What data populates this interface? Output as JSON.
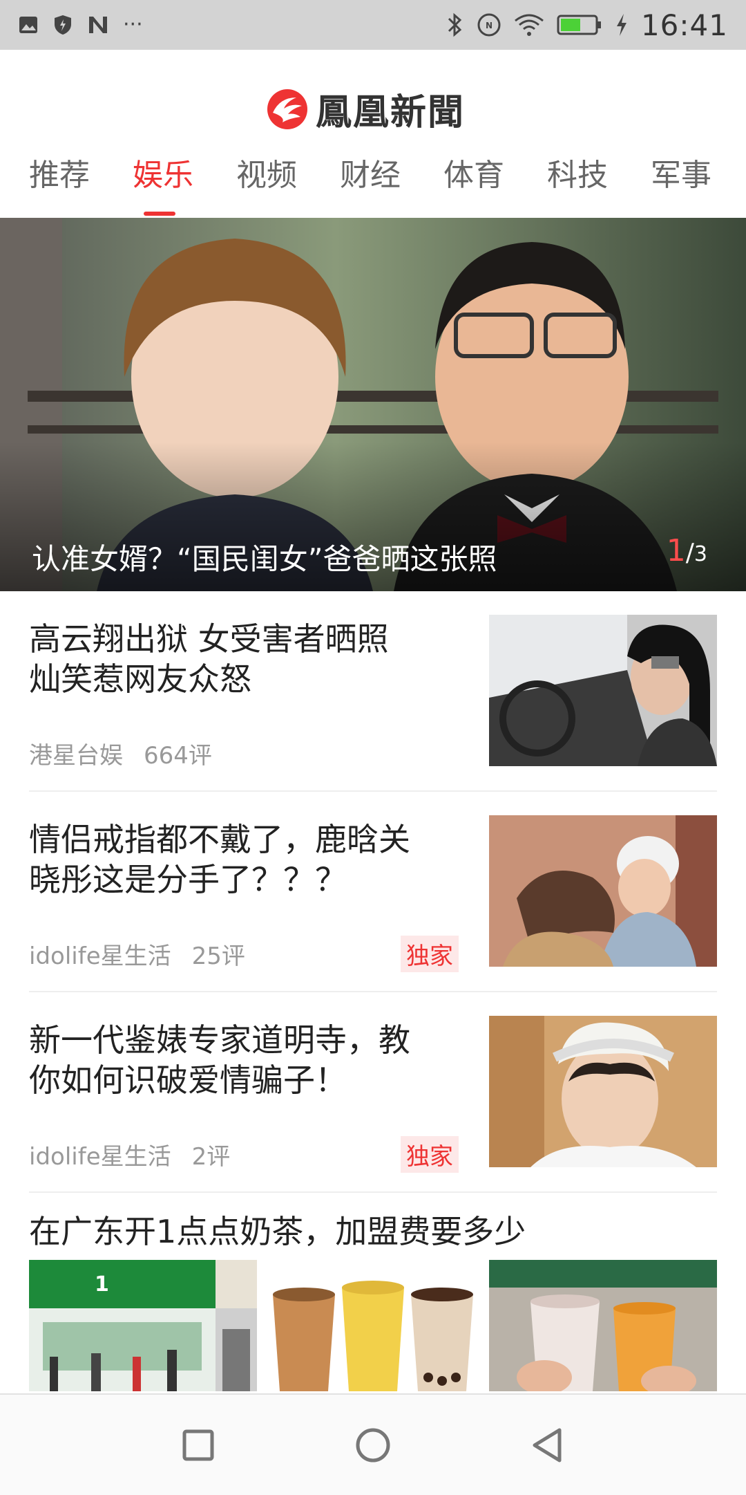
{
  "status_bar": {
    "time": "16:41",
    "left_icons": [
      "image-icon",
      "shield-icon",
      "n-app-icon",
      "more-dots-icon"
    ],
    "right_icons": [
      "bluetooth-icon",
      "nfc-icon",
      "wifi-icon",
      "battery-icon",
      "charging-icon"
    ],
    "more_dots": "···"
  },
  "header": {
    "logo_text": "鳳凰新聞",
    "tabs": [
      {
        "label": "推荐",
        "active": false
      },
      {
        "label": "娱乐",
        "active": true
      },
      {
        "label": "视频",
        "active": false
      },
      {
        "label": "财经",
        "active": false
      },
      {
        "label": "体育",
        "active": false
      },
      {
        "label": "科技",
        "active": false
      },
      {
        "label": "军事",
        "active": false
      }
    ]
  },
  "hero": {
    "caption": "认准女婿？“国民闺女”爸爸晒这张照",
    "index_current": "1",
    "index_sep": "/",
    "index_total": "3"
  },
  "articles": [
    {
      "title_line1": "高云翔出狱 女受害者晒照",
      "title_line2": "灿笑惹网友众怒",
      "source": "港星台娱",
      "comments": "664评",
      "badge": ""
    },
    {
      "title_line1": "情侣戒指都不戴了，鹿晗关",
      "title_line2": "晓彤这是分手了？？？",
      "source": "idolife星生活",
      "comments": "25评",
      "badge": "独家"
    },
    {
      "title_line1": "新一代鉴婊专家道明寺，教",
      "title_line2": "你如何识破爱情骗子！",
      "source": "idolife星生活",
      "comments": "2评",
      "badge": "独家"
    }
  ],
  "multi_article": {
    "title": "在广东开1点点奶茶，加盟费要多少"
  },
  "colors": {
    "accent": "#e33333",
    "status_bar_bg": "#d3d3d3",
    "battery_fill": "#4cd137"
  },
  "nav_bar": {
    "buttons": [
      "recents-square-icon",
      "home-circle-icon",
      "back-triangle-icon"
    ]
  }
}
